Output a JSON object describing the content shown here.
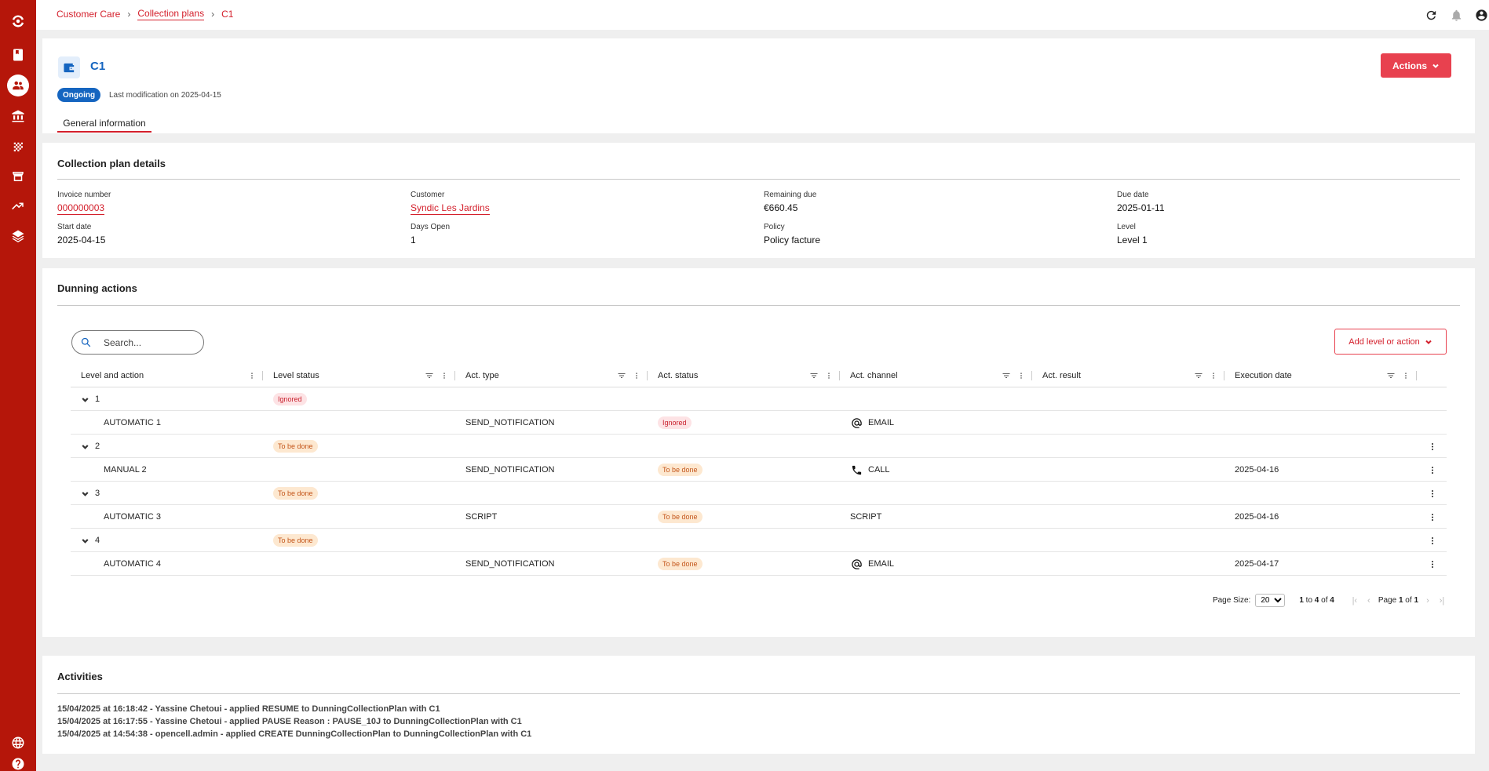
{
  "breadcrumb": {
    "root": "Customer Care",
    "parent": "Collection plans",
    "current": "C1"
  },
  "header": {
    "title": "C1",
    "status": "Ongoing",
    "last_modification": "Last modification on 2025-04-15",
    "tab": "General information",
    "actions_label": "Actions"
  },
  "details": {
    "title": "Collection plan details",
    "invoice_number_label": "Invoice number",
    "invoice_number": "000000003",
    "customer_label": "Customer",
    "customer": "Syndic Les Jardins",
    "remaining_due_label": "Remaining due",
    "remaining_due": "€660.45",
    "due_date_label": "Due date",
    "due_date": "2025-01-11",
    "start_date_label": "Start date",
    "start_date": "2025-04-15",
    "days_open_label": "Days Open",
    "days_open": "1",
    "policy_label": "Policy",
    "policy": "Policy facture",
    "level_label": "Level",
    "level": "Level 1"
  },
  "dunning": {
    "title": "Dunning actions",
    "search_placeholder": "Search...",
    "add_label": "Add level or action",
    "columns": [
      "Level and action",
      "Level status",
      "Act. type",
      "Act. status",
      "Act. channel",
      "Act. result",
      "Execution date"
    ],
    "rows": [
      {
        "kind": "level",
        "name": "1",
        "level_status": "Ignored",
        "menu": false
      },
      {
        "kind": "action",
        "name": "AUTOMATIC 1",
        "type": "SEND_NOTIFICATION",
        "status": "Ignored",
        "channel_icon": "at-icon",
        "channel": "EMAIL",
        "date": "",
        "menu": false
      },
      {
        "kind": "level",
        "name": "2",
        "level_status": "To be done",
        "menu": true
      },
      {
        "kind": "action",
        "name": "MANUAL 2",
        "type": "SEND_NOTIFICATION",
        "status": "To be done",
        "channel_icon": "phone-icon",
        "channel": "CALL",
        "date": "2025-04-16",
        "menu": true
      },
      {
        "kind": "level",
        "name": "3",
        "level_status": "To be done",
        "menu": true
      },
      {
        "kind": "action",
        "name": "AUTOMATIC 3",
        "type": "SCRIPT",
        "status": "To be done",
        "channel_icon": "",
        "channel": "SCRIPT",
        "date": "2025-04-16",
        "menu": true
      },
      {
        "kind": "level",
        "name": "4",
        "level_status": "To be done",
        "menu": true
      },
      {
        "kind": "action",
        "name": "AUTOMATIC 4",
        "type": "SEND_NOTIFICATION",
        "status": "To be done",
        "channel_icon": "at-icon",
        "channel": "EMAIL",
        "date": "2025-04-17",
        "menu": true
      }
    ],
    "pager": {
      "page_size_label": "Page Size:",
      "page_size": "20",
      "range_from": "1",
      "range_to": "4",
      "range_total": "4",
      "page_label": "Page",
      "page": "1",
      "page_of": "1"
    }
  },
  "activities": {
    "title": "Activities",
    "lines": [
      "15/04/2025 at 16:18:42 - Yassine Chetoui - applied RESUME to DunningCollectionPlan with C1",
      "15/04/2025 at 16:17:55 - Yassine Chetoui - applied PAUSE Reason : PAUSE_10J to DunningCollectionPlan with C1",
      "15/04/2025 at 14:54:38 - opencell.admin - applied CREATE DunningCollectionPlan to DunningCollectionPlan with C1"
    ]
  },
  "colors": {
    "brand": "#b5160a",
    "accent": "#d4202c",
    "primary_blue": "#1565c0"
  }
}
